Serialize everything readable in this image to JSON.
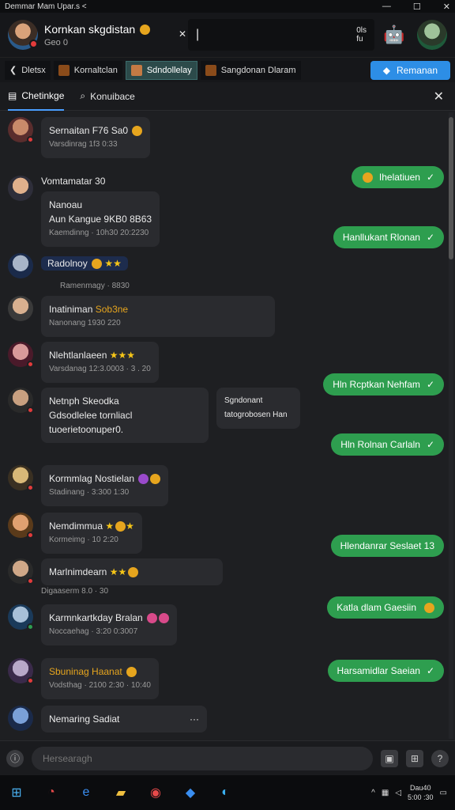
{
  "window": {
    "title": "Demmar Mam Upar.s <",
    "ctl_min": "—",
    "ctl_max": "☐",
    "ctl_close": "✕"
  },
  "header": {
    "name": "Kornkan skgdistan",
    "status": "Geo 0",
    "search_text": "|",
    "search_right": "0ls\nfu"
  },
  "tabs": [
    {
      "label": "Dletsx"
    },
    {
      "label": "Kornaltclan"
    },
    {
      "label": "Sdndollelay"
    },
    {
      "label": "Sangdonan Dlaram"
    }
  ],
  "action_button": "Remanan",
  "subtabs": {
    "chats": "Chetinkge",
    "search": "Konuibace"
  },
  "messages": [
    {
      "text": "Sernaitan F76 Sa0",
      "meta": "Varsdinrag 1f3 0:33"
    },
    {
      "head": "Vomtamatar 30",
      "line1": "Nanoau",
      "line2": "Aun Kangue 9KB0 8B63",
      "meta": "Kaemdinng · 10h30 20:2230"
    },
    {
      "text": "Radolnoy"
    },
    {
      "meta_top": "Ramenmagy · 8830",
      "text": "Inatiniman",
      "hl": "Sob3ne",
      "meta": "Nanonang 1930 220"
    },
    {
      "text": "Nlehtlanlaeen",
      "meta": "Varsdanag 12:3.0003 · 3 . 20"
    },
    {
      "line1": "Netnph Skeodka",
      "line2": "Gdsodlelee tornliacl",
      "line3": "tuoerietoonuper0.",
      "side": "Sgndonant tatogrobosen Han"
    },
    {
      "text": "Kormmlag Nostielan",
      "meta": "Stadinang · 3:300 1:30"
    },
    {
      "text": "Nemdimmua",
      "meta": "Kormeimg · 10 2:20"
    },
    {
      "text": "Marlnimdearn",
      "meta": "Digaaserm 8.0 · 30"
    },
    {
      "text": "Karmnkartkday Bralan",
      "meta": "Noccaehag · 3:20 0:3007"
    },
    {
      "text": "Sbuninag Haanat",
      "meta": "Vodsthag · 2100 2:30 · 10:40"
    },
    {
      "text": "Nemaring Sadiat"
    }
  ],
  "outgoing": [
    "Ihelatiuen",
    "Hanllukant Rlonan",
    "Hln Rcptkan Nehfam",
    "Hln Rolnan Carlaln",
    "Hlendanrar Seslaet 13",
    "Katla dlam Gaesiin",
    "Harsamidlar Saeian"
  ],
  "composer": {
    "placeholder": "Hersearagh"
  },
  "taskbar": {
    "time": "Dau40",
    "date": "5:00 :30"
  }
}
